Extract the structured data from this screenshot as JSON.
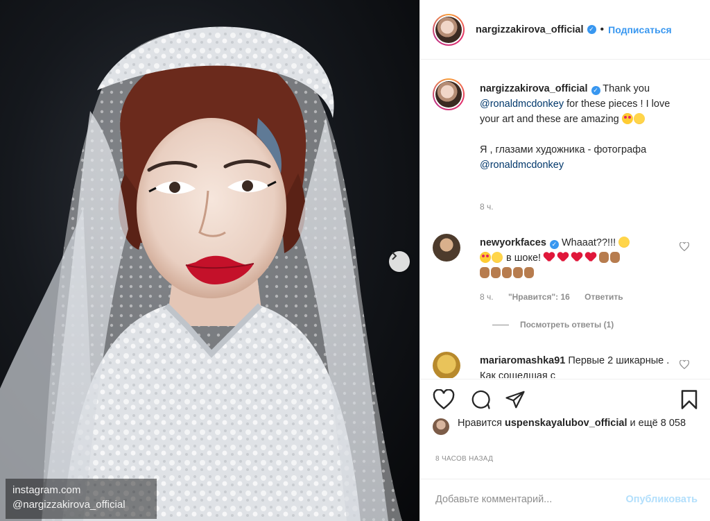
{
  "photo": {
    "watermark_line1": "instagram.com",
    "watermark_line2": "@nargizzakirova_official"
  },
  "header": {
    "username": "nargizzakirova_official",
    "verified_icon": "verified-badge-icon",
    "separator": "•",
    "follow_label": "Подписаться"
  },
  "caption": {
    "username": "nargizzakirova_official",
    "text_a": " Thank you ",
    "mention1": "@ronaldmcdonkey",
    "text_b": " for these pieces ! I love your art and these are amazing ",
    "text_c": "Я , глазами художника - фотографа ",
    "mention2": "@ronaldmcdonkey",
    "time": "8 ч."
  },
  "comments": [
    {
      "username": "newyorkfaces",
      "text_a": " Whaaat??!!! ",
      "text_b": " в шоке! ",
      "time": "8 ч.",
      "likes": "\"Нравится\": 16",
      "reply_label": "Ответить",
      "view_replies": "Посмотреть ответы (1)"
    },
    {
      "username": "mariaromashka91",
      "text_a": " Первые 2 шикарные . Как сошедшая с"
    }
  ],
  "likes": {
    "prefix": "Нравится ",
    "username": "uspenskayalubov_official",
    "suffix": " и ещё 8 058"
  },
  "time_ago": "8 ЧАСОВ НАЗАД",
  "add_comment": {
    "placeholder": "Добавьте комментарий...",
    "publish_label": "Опубликовать"
  },
  "colors": {
    "accent": "#3897f0",
    "mention": "#00376b",
    "muted": "#8e8e8e",
    "publish_disabled": "#b2dffc",
    "heart_red": "#e0173a"
  }
}
